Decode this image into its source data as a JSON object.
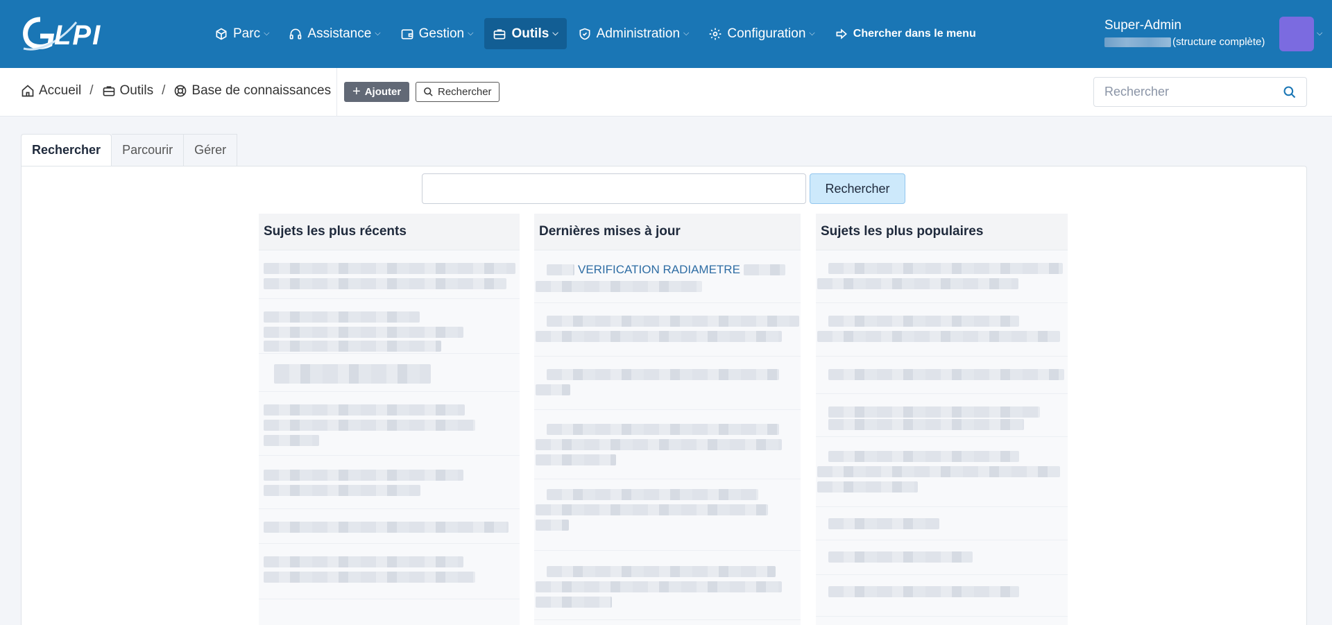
{
  "navbar": {
    "logo_text": "GLPI",
    "items": [
      {
        "label": "Parc",
        "icon": "box-icon"
      },
      {
        "label": "Assistance",
        "icon": "headset-icon"
      },
      {
        "label": "Gestion",
        "icon": "wallet-icon"
      },
      {
        "label": "Outils",
        "icon": "briefcase-icon",
        "active": true
      },
      {
        "label": "Administration",
        "icon": "shield-icon"
      },
      {
        "label": "Configuration",
        "icon": "gear-icon"
      }
    ],
    "menu_search_label": "Chercher dans le menu",
    "user": {
      "name": "Super-Admin",
      "entity": "(structure complète)"
    }
  },
  "subheader": {
    "breadcrumb": [
      {
        "label": "Accueil",
        "icon": "home-icon"
      },
      {
        "label": "Outils",
        "icon": "briefcase-icon"
      },
      {
        "label": "Base de connaissances",
        "icon": "lifebuoy-icon"
      }
    ],
    "add_label": "Ajouter",
    "search_label": "Rechercher",
    "global_search_placeholder": "Rechercher"
  },
  "tabs": [
    {
      "label": "Rechercher",
      "active": true
    },
    {
      "label": "Parcourir"
    },
    {
      "label": "Gérer"
    }
  ],
  "kb_search": {
    "value": "",
    "button_label": "Rechercher"
  },
  "columns": {
    "recent": {
      "title": "Sujets les plus récents"
    },
    "updated": {
      "title": "Dernières mises à jour",
      "first_item": "VERIFICATION RADIAMETRE"
    },
    "popular": {
      "title": "Sujets les plus populaires"
    }
  },
  "colors": {
    "navbar": "#1a76b5",
    "active_nav": "#125e94",
    "link": "#2e6da4",
    "avatar": "#7b6be0"
  }
}
